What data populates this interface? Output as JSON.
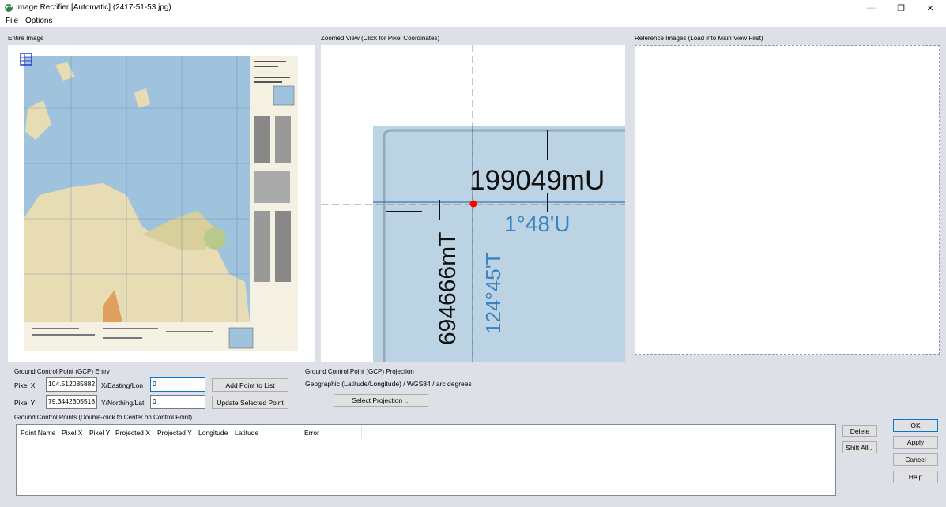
{
  "window": {
    "title": "Image Rectifier [Automatic] (2417-51-53.jpg)",
    "minimize_glyph": "—",
    "restore_glyph": "❐",
    "close_glyph": "✕"
  },
  "menu": {
    "items": [
      "File",
      "Options"
    ]
  },
  "panels": {
    "entire_image_label": "Entire Image",
    "zoomed_view_label": "Zoomed View (Click for Pixel Coordinates)",
    "reference_images_label": "Reference Images (Load into Main View First)"
  },
  "zoom_text": {
    "easting": "199049mU",
    "northing": "694666mT",
    "lat_minutes": "1°48'U",
    "lon_degrees": "124°45'T"
  },
  "gcp_entry": {
    "label": "Ground Control Point (GCP) Entry",
    "pixel_x_label": "Pixel X",
    "pixel_x_value": "104.512085882",
    "pixel_y_label": "Pixel Y",
    "pixel_y_value": "79.3442305518",
    "x_label": "X/Easting/Lon",
    "x_value": "0",
    "y_label": "Y/Northing/Lat",
    "y_value": "0",
    "add_button": "Add Point to List",
    "update_button": "Update Selected Point"
  },
  "gcp_projection": {
    "label": "Ground Control Point (GCP) Projection",
    "value": "Geographic (Latitude/Longitude) / WGS84 / arc degrees",
    "select_button": "Select Projection ..."
  },
  "gcp_list": {
    "label": "Ground Control Points (Double-click to Center on Control Point)",
    "columns": [
      "Point Name",
      "Pixel X",
      "Pixel Y",
      "Projected X",
      "Projected Y",
      "Longitude",
      "Latitude",
      "Error"
    ]
  },
  "side_buttons": {
    "delete": "Delete",
    "shift_all": "Shift All..."
  },
  "dialog_buttons": {
    "ok": "OK",
    "apply": "Apply",
    "cancel": "Cancel",
    "help": "Help"
  },
  "colors": {
    "map_sea": "#9fc3dc",
    "map_land": "#e8dcb4",
    "zoom_tile": "#bcd3e3",
    "crosshair_point": "#ff0000",
    "dialog_bg": "#dde0e6"
  }
}
